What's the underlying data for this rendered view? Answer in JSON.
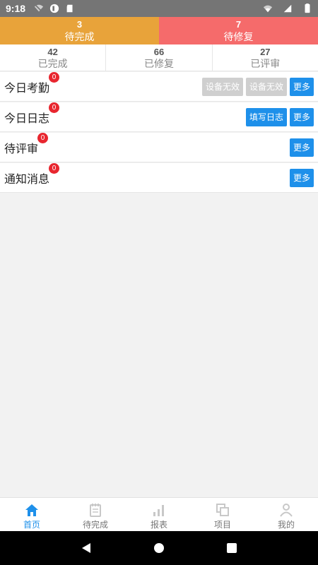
{
  "status_bar": {
    "time": "9:18"
  },
  "summary": [
    {
      "count": "3",
      "label": "待完成"
    },
    {
      "count": "7",
      "label": "待修复"
    }
  ],
  "stats": [
    {
      "count": "42",
      "label": "已完成"
    },
    {
      "count": "66",
      "label": "已修复"
    },
    {
      "count": "27",
      "label": "已评审"
    }
  ],
  "rows": [
    {
      "title": "今日考勤",
      "badge": "0",
      "buttons": [
        "设备无效",
        "设备无效"
      ],
      "more": "更多"
    },
    {
      "title": "今日日志",
      "badge": "0",
      "buttons": [
        "填写日志"
      ],
      "more": "更多"
    },
    {
      "title": "待评审",
      "badge": "0",
      "buttons": [],
      "more": "更多"
    },
    {
      "title": "通知消息",
      "badge": "0",
      "buttons": [],
      "more": "更多"
    }
  ],
  "tabs": [
    {
      "label": "首页",
      "icon": "home-icon",
      "active": true
    },
    {
      "label": "待完成",
      "icon": "notepad-icon",
      "active": false
    },
    {
      "label": "报表",
      "icon": "bar-chart-icon",
      "active": false
    },
    {
      "label": "项目",
      "icon": "copy-icon",
      "active": false
    },
    {
      "label": "我的",
      "icon": "person-icon",
      "active": false
    }
  ],
  "colors": {
    "pending": "#e8a33a",
    "repair": "#f56b6b",
    "accent": "#1e90ea",
    "badge": "#e8262f",
    "disabled_button": "#cfcfcf"
  }
}
